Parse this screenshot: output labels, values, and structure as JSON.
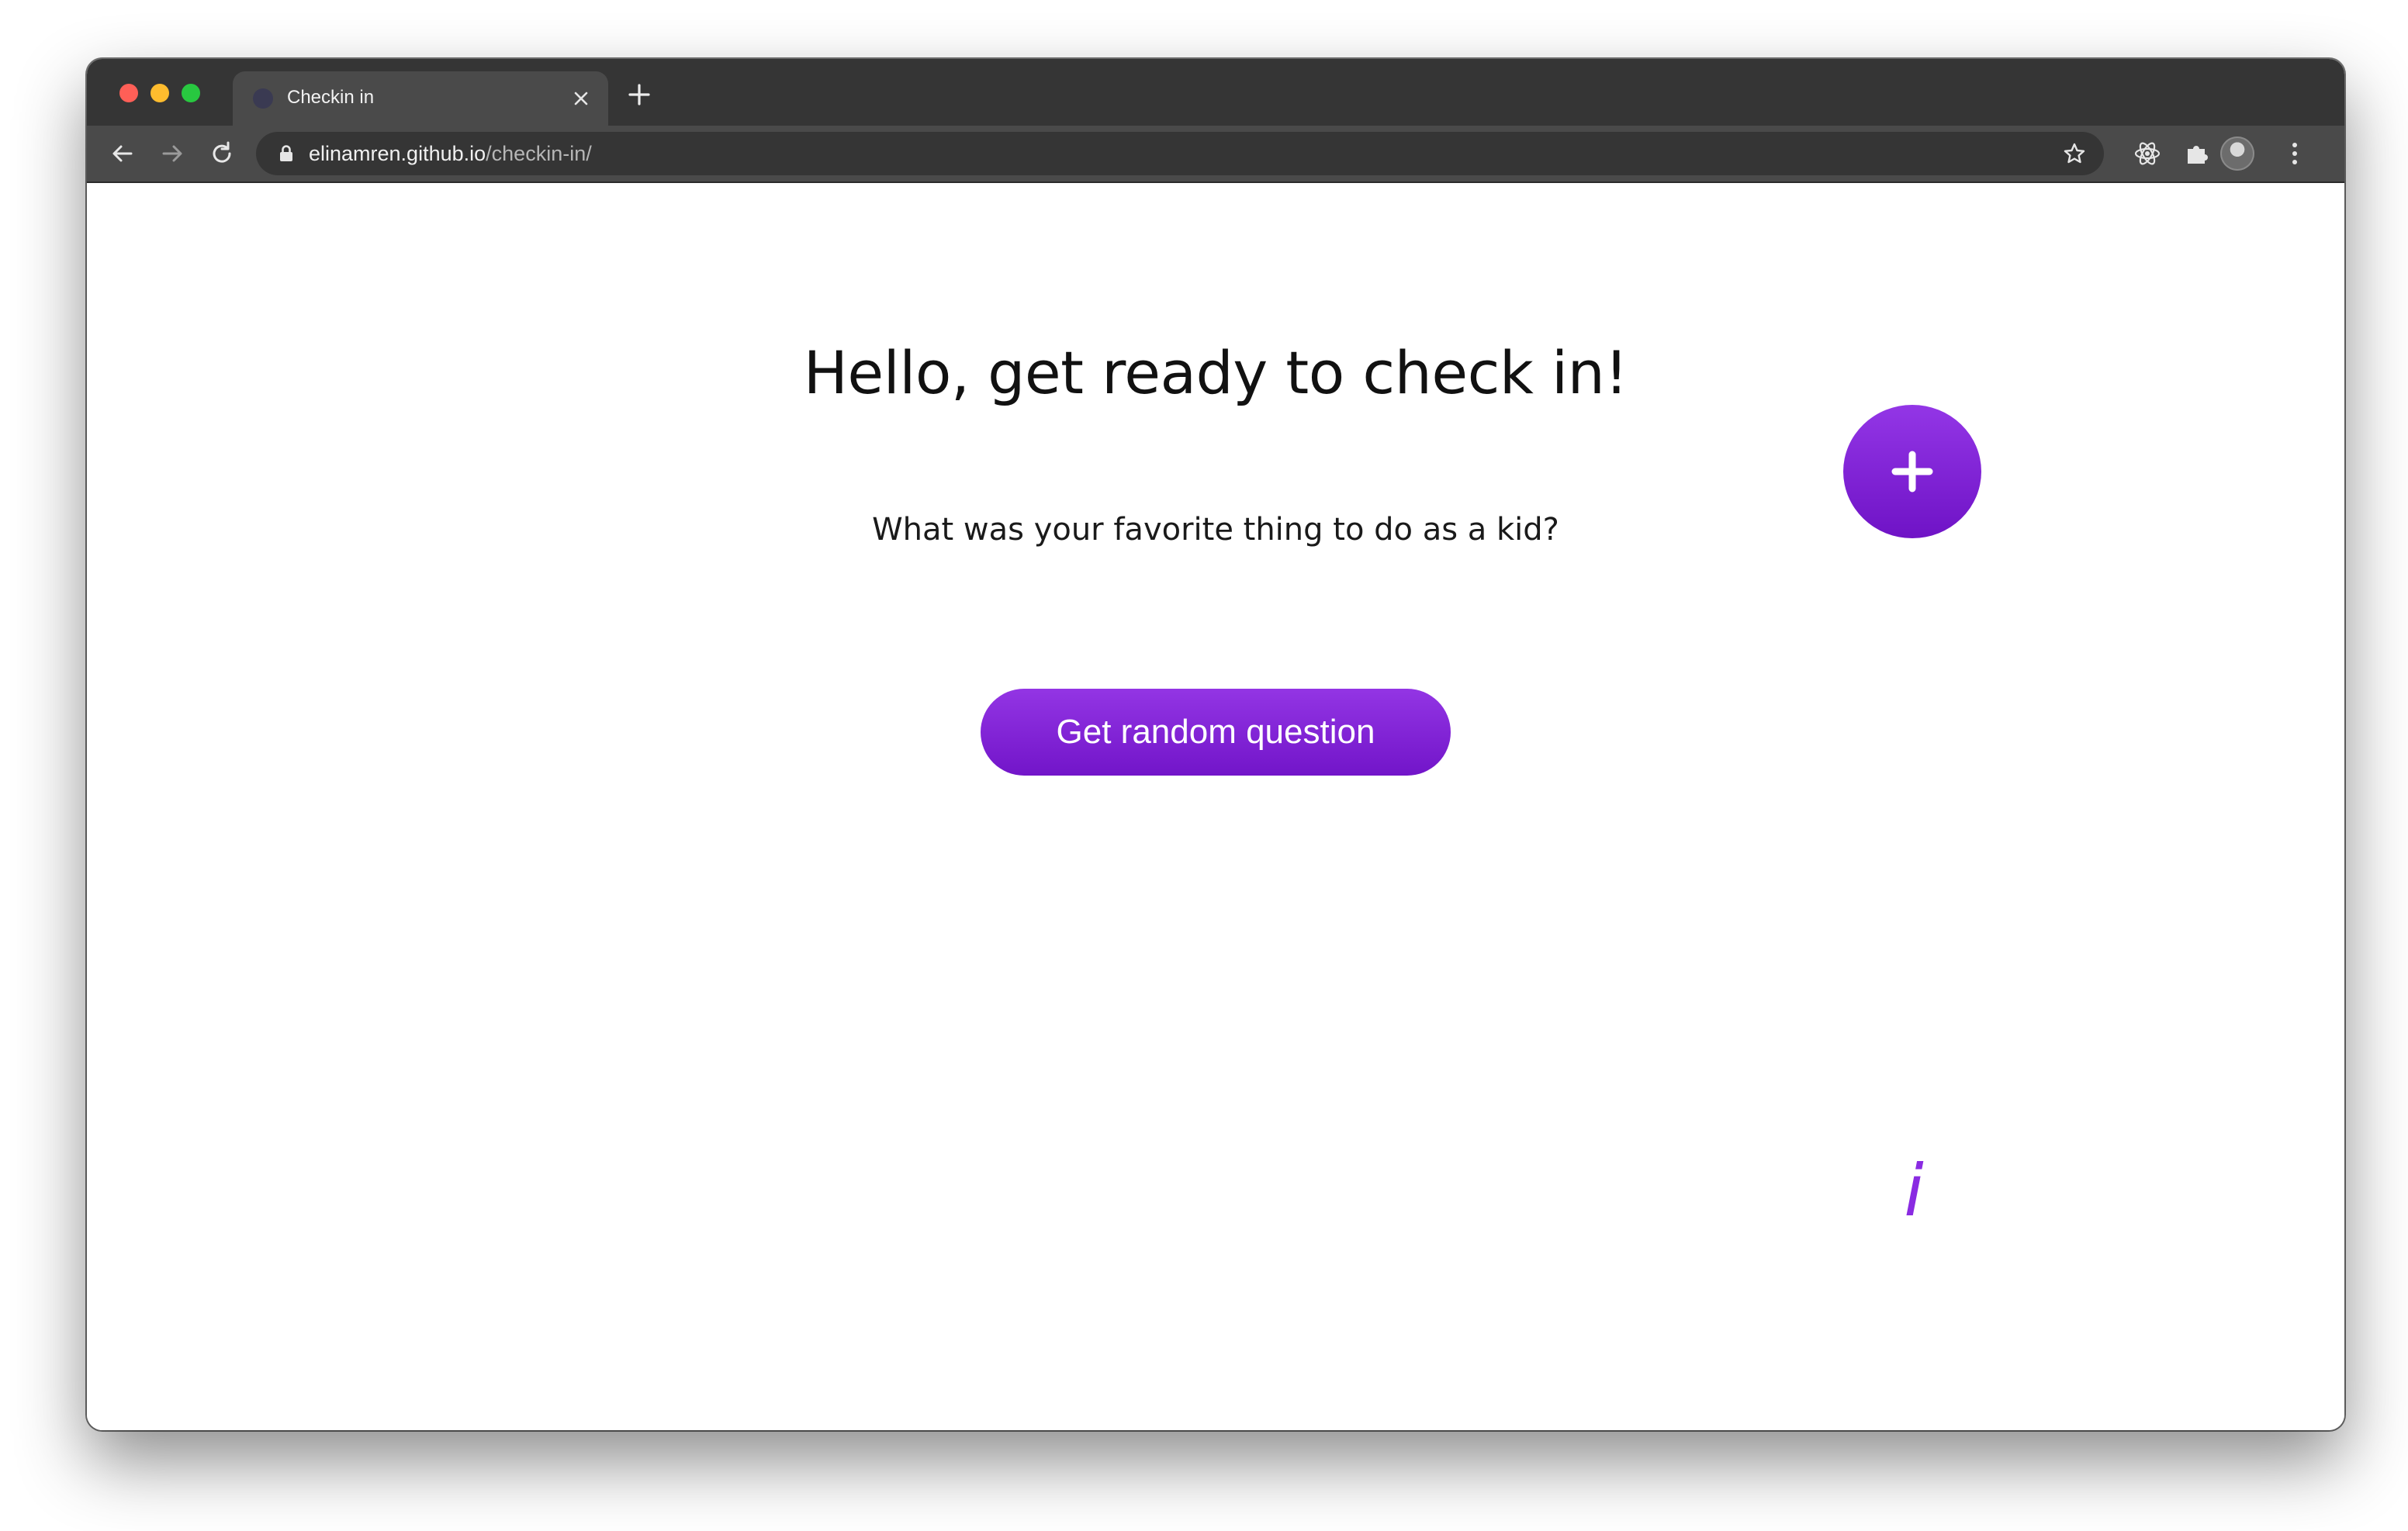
{
  "browser": {
    "tab_title": "Checkin in",
    "url_host": "elinamren.github.io",
    "url_path": "/checkin-in/"
  },
  "page": {
    "heading": "Hello, get ready to check in!",
    "question": "What was your favorite thing to do as a kid?",
    "random_button_label": "Get random question",
    "info_label": "i"
  },
  "icons": {
    "add": "plus-icon",
    "info": "info-icon",
    "back": "arrow-left-icon",
    "forward": "arrow-right-icon",
    "reload": "reload-icon",
    "lock": "lock-icon",
    "bookmark": "star-icon",
    "react_devtools": "react-icon",
    "extensions": "puzzle-icon",
    "menu": "kebab-menu-icon"
  },
  "colors": {
    "accent": "#8a2be2",
    "button_gradient_top": "#9335e4",
    "button_gradient_bottom": "#7215c9"
  }
}
